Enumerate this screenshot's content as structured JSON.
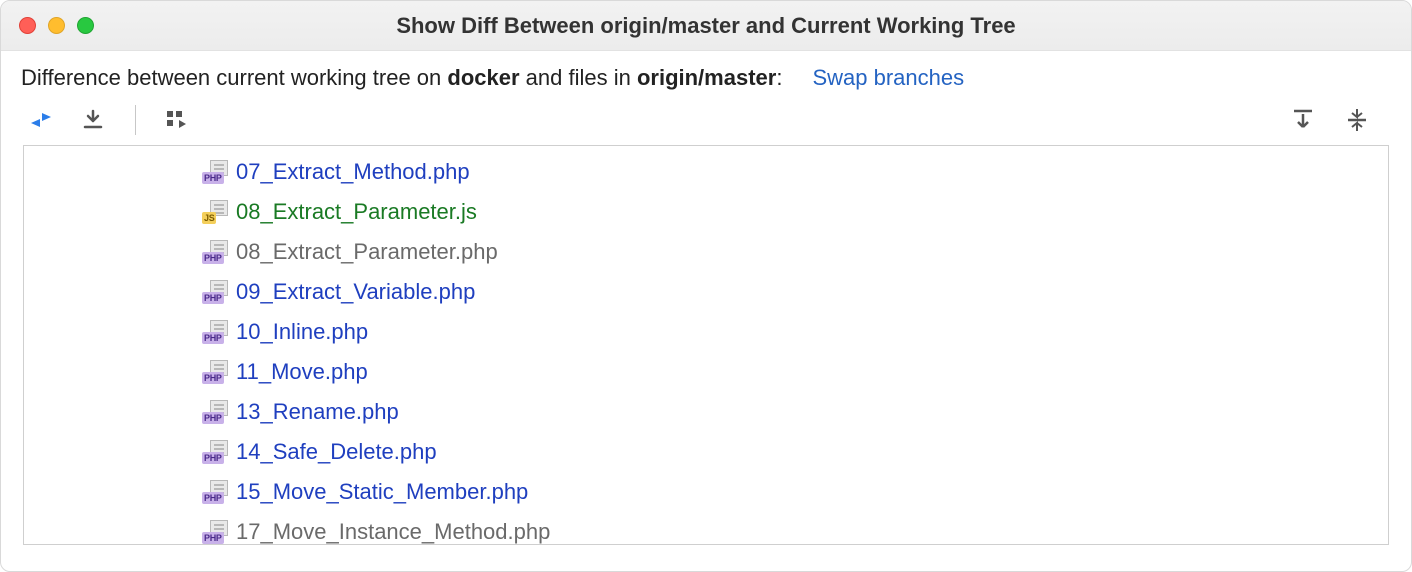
{
  "window": {
    "title": "Show Diff Between origin/master and Current Working Tree"
  },
  "subheader": {
    "prefix": "Difference between current working tree on ",
    "branch_local": "docker",
    "middle": " and files in ",
    "branch_remote": "origin/master",
    "suffix": ":",
    "swap_link": "Swap branches"
  },
  "toolbar_icons": {
    "swap_panes": "swap-panes-icon",
    "download": "download-icon",
    "group_by": "group-by-icon",
    "expand_all": "expand-all-icon",
    "collapse_all": "collapse-all-icon"
  },
  "files": [
    {
      "name": "07_Extract_Method.php",
      "type": "php",
      "color": "blue"
    },
    {
      "name": "08_Extract_Parameter.js",
      "type": "js",
      "color": "green"
    },
    {
      "name": "08_Extract_Parameter.php",
      "type": "php",
      "color": "gray"
    },
    {
      "name": "09_Extract_Variable.php",
      "type": "php",
      "color": "blue"
    },
    {
      "name": "10_Inline.php",
      "type": "php",
      "color": "blue"
    },
    {
      "name": "11_Move.php",
      "type": "php",
      "color": "blue"
    },
    {
      "name": "13_Rename.php",
      "type": "php",
      "color": "blue"
    },
    {
      "name": "14_Safe_Delete.php",
      "type": "php",
      "color": "blue"
    },
    {
      "name": "15_Move_Static_Member.php",
      "type": "php",
      "color": "blue"
    },
    {
      "name": "17_Move_Instance_Method.php",
      "type": "php",
      "color": "gray"
    }
  ]
}
